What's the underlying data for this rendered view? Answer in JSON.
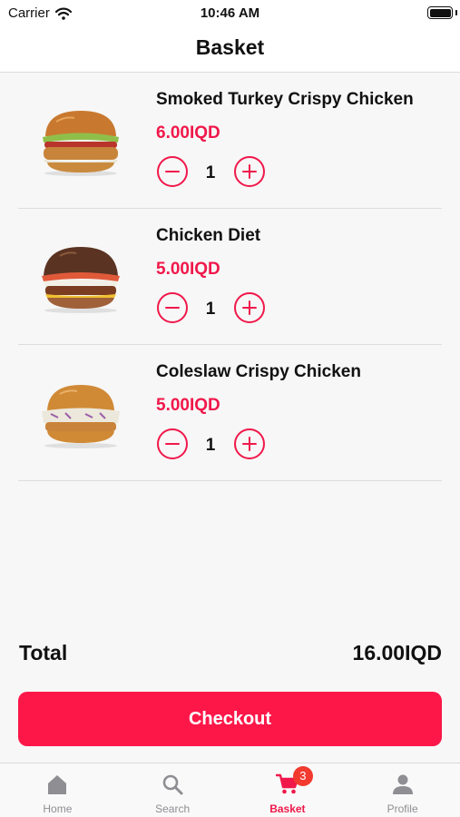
{
  "status_bar": {
    "carrier": "Carrier",
    "time": "10:46 AM"
  },
  "header": {
    "title": "Basket"
  },
  "items": [
    {
      "name": "Smoked Turkey Crispy Chicken",
      "price": "6.00IQD",
      "quantity": "1"
    },
    {
      "name": "Chicken Diet",
      "price": "5.00IQD",
      "quantity": "1"
    },
    {
      "name": "Coleslaw Crispy Chicken",
      "price": "5.00IQD",
      "quantity": "1"
    }
  ],
  "summary": {
    "total_label": "Total",
    "total_value": "16.00IQD"
  },
  "checkout": {
    "label": "Checkout"
  },
  "tabs": [
    {
      "label": "Home",
      "icon": "home-icon"
    },
    {
      "label": "Search",
      "icon": "search-icon"
    },
    {
      "label": "Basket",
      "icon": "cart-icon",
      "badge": "3",
      "active": true
    },
    {
      "label": "Profile",
      "icon": "profile-icon"
    }
  ],
  "colors": {
    "accent": "#f0184a",
    "checkout": "#fd1749",
    "badge": "#f23a2f"
  }
}
